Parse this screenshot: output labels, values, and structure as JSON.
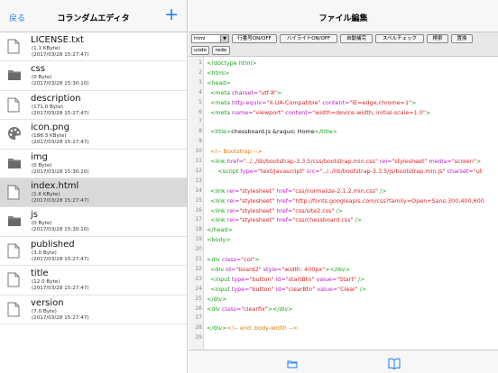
{
  "left": {
    "back_label": "戻る",
    "title": "コランダムエディタ",
    "add_label": "+"
  },
  "files": [
    {
      "name": "LICENSE.txt",
      "size": "(1.1 KByte)",
      "date": "(2017/03/28 15:27:47)",
      "icon": "document-icon",
      "selected": false
    },
    {
      "name": "css",
      "size": "(0 Byte)",
      "date": "(2017/03/28 15:30:10)",
      "icon": "folder-icon",
      "selected": false
    },
    {
      "name": "description",
      "size": "(171.0 Byte)",
      "date": "(2017/03/28 15:27:47)",
      "icon": "document-icon",
      "selected": false
    },
    {
      "name": "icon.png",
      "size": "(186.3 KByte)",
      "date": "(2017/03/28 15:27:47)",
      "icon": "palette-icon",
      "selected": false
    },
    {
      "name": "img",
      "size": "(0 Byte)",
      "date": "(2017/03/28 15:30:10)",
      "icon": "folder-icon",
      "selected": false
    },
    {
      "name": "index.html",
      "size": "(1.6 KByte)",
      "date": "(2017/03/28 15:27:47)",
      "icon": "document-icon",
      "selected": true
    },
    {
      "name": "js",
      "size": "(0 Byte)",
      "date": "(2017/03/28 15:30:10)",
      "icon": "folder-icon",
      "selected": false
    },
    {
      "name": "published",
      "size": "(3.0 Byte)",
      "date": "(2017/03/28 15:27:47)",
      "icon": "document-icon",
      "selected": false
    },
    {
      "name": "title",
      "size": "(12.0 Byte)",
      "date": "(2017/03/28 15:27:47)",
      "icon": "document-icon",
      "selected": false
    },
    {
      "name": "version",
      "size": "(7.0 Byte)",
      "date": "(2017/03/28 15:27:47)",
      "icon": "document-icon",
      "selected": false
    }
  ],
  "right": {
    "title": "ファイル編集"
  },
  "toolbar": {
    "mode_value": "html",
    "mode_arrow": "▼",
    "line_numbers": "行番号ON/OFF",
    "highlight": "ハイライトON/OFF",
    "autocomplete": "自動補完",
    "spellcheck": "スペルチェック",
    "search": "検索",
    "replace": "置換",
    "undo": "undo",
    "redo": "redo"
  },
  "code_lines": [
    {
      "n": "1",
      "parts": [
        {
          "c": "tag",
          "t": "<!doctype html>"
        }
      ]
    },
    {
      "n": "2",
      "parts": [
        {
          "c": "tag",
          "t": "<html>"
        }
      ]
    },
    {
      "n": "3",
      "parts": [
        {
          "c": "tag",
          "t": "<head>"
        }
      ]
    },
    {
      "n": "4",
      "parts": [
        {
          "c": "tag",
          "t": "  <meta "
        },
        {
          "c": "attr",
          "t": "charset="
        },
        {
          "c": "val",
          "t": "\"utf-8\""
        },
        {
          "c": "tag",
          "t": ">"
        }
      ]
    },
    {
      "n": "5",
      "parts": [
        {
          "c": "tag",
          "t": "  <meta "
        },
        {
          "c": "attr",
          "t": "http-equiv="
        },
        {
          "c": "val",
          "t": "\"X-UA-Compatible\""
        },
        {
          "c": "attr",
          "t": " content="
        },
        {
          "c": "val",
          "t": "\"IE=edge,chrome=1\""
        },
        {
          "c": "tag",
          "t": ">"
        }
      ]
    },
    {
      "n": "6",
      "parts": [
        {
          "c": "tag",
          "t": "  <meta "
        },
        {
          "c": "attr",
          "t": "name="
        },
        {
          "c": "val",
          "t": "\"viewport\""
        },
        {
          "c": "attr",
          "t": " content="
        },
        {
          "c": "val",
          "t": "\"width=device-width, initial-scale=1.0\""
        },
        {
          "c": "tag",
          "t": ">"
        }
      ]
    },
    {
      "n": "7",
      "parts": []
    },
    {
      "n": "8",
      "parts": [
        {
          "c": "tag",
          "t": "  <title>"
        },
        {
          "c": "txt",
          "t": "chessboard.js &raquo; Home"
        },
        {
          "c": "tag",
          "t": "</title>"
        }
      ]
    },
    {
      "n": "9",
      "parts": []
    },
    {
      "n": "10",
      "parts": [
        {
          "c": "cmt",
          "t": "  <!-- Bootstrap -->"
        }
      ]
    },
    {
      "n": "11",
      "parts": [
        {
          "c": "tag",
          "t": "  <link "
        },
        {
          "c": "attr",
          "t": "href="
        },
        {
          "c": "val",
          "t": "\"../../lib/bootstrap-3.3.5/css/bootstrap.min.css\""
        },
        {
          "c": "attr",
          "t": " rel="
        },
        {
          "c": "val",
          "t": "\"stylesheet\""
        },
        {
          "c": "attr",
          "t": " media="
        },
        {
          "c": "val",
          "t": "\"screen\""
        },
        {
          "c": "tag",
          "t": ">"
        }
      ]
    },
    {
      "n": "12",
      "parts": [
        {
          "c": "tag",
          "t": "      <script "
        },
        {
          "c": "attr",
          "t": "type="
        },
        {
          "c": "val",
          "t": "\"text/javascript\""
        },
        {
          "c": "attr",
          "t": " src="
        },
        {
          "c": "val",
          "t": "\"../../lib/bootstrap-3.3.5/js/bootstrap.min.js\""
        },
        {
          "c": "attr",
          "t": " charset="
        },
        {
          "c": "val",
          "t": "\"ut"
        }
      ]
    },
    {
      "n": "13",
      "parts": []
    },
    {
      "n": "14",
      "parts": [
        {
          "c": "tag",
          "t": "  <link "
        },
        {
          "c": "attr",
          "t": "rel="
        },
        {
          "c": "val",
          "t": "\"stylesheet\""
        },
        {
          "c": "attr",
          "t": " href="
        },
        {
          "c": "val",
          "t": "\"css/normalize-2.1.2.min.css\""
        },
        {
          "c": "tag",
          "t": " />"
        }
      ]
    },
    {
      "n": "15",
      "parts": [
        {
          "c": "tag",
          "t": "  <link "
        },
        {
          "c": "attr",
          "t": "rel="
        },
        {
          "c": "val",
          "t": "\"stylesheet\""
        },
        {
          "c": "attr",
          "t": " href="
        },
        {
          "c": "val",
          "t": "\"http://fonts.googleapis.com/css?family=Open+Sans:300,400,600"
        }
      ]
    },
    {
      "n": "16",
      "parts": [
        {
          "c": "tag",
          "t": "  <link "
        },
        {
          "c": "attr",
          "t": "rel="
        },
        {
          "c": "val",
          "t": "\"stylesheet\""
        },
        {
          "c": "attr",
          "t": " href="
        },
        {
          "c": "val",
          "t": "\"css/site2.css\""
        },
        {
          "c": "tag",
          "t": " />"
        }
      ]
    },
    {
      "n": "17",
      "parts": [
        {
          "c": "tag",
          "t": "  <link "
        },
        {
          "c": "attr",
          "t": "rel="
        },
        {
          "c": "val",
          "t": "\"stylesheet\""
        },
        {
          "c": "attr",
          "t": " href="
        },
        {
          "c": "val",
          "t": "\"css/chessboard.css\""
        },
        {
          "c": "tag",
          "t": " />"
        }
      ]
    },
    {
      "n": "18",
      "parts": [
        {
          "c": "tag",
          "t": "</head>"
        }
      ]
    },
    {
      "n": "19",
      "parts": [
        {
          "c": "tag",
          "t": "<body>"
        }
      ]
    },
    {
      "n": "20",
      "parts": []
    },
    {
      "n": "21",
      "parts": [
        {
          "c": "tag",
          "t": "<div "
        },
        {
          "c": "attr",
          "t": "class="
        },
        {
          "c": "val",
          "t": "\"col\""
        },
        {
          "c": "tag",
          "t": ">"
        }
      ]
    },
    {
      "n": "22",
      "parts": [
        {
          "c": "tag",
          "t": "  <div "
        },
        {
          "c": "attr",
          "t": "id="
        },
        {
          "c": "val",
          "t": "\"board2\""
        },
        {
          "c": "attr",
          "t": " style="
        },
        {
          "c": "val",
          "t": "\"width: 400px\""
        },
        {
          "c": "tag",
          "t": "></div>"
        }
      ]
    },
    {
      "n": "23",
      "parts": [
        {
          "c": "tag",
          "t": "  <input "
        },
        {
          "c": "attr",
          "t": "type="
        },
        {
          "c": "val",
          "t": "\"button\""
        },
        {
          "c": "attr",
          "t": " id="
        },
        {
          "c": "val",
          "t": "\"startBtn\""
        },
        {
          "c": "attr",
          "t": " value="
        },
        {
          "c": "val",
          "t": "\"Start\""
        },
        {
          "c": "tag",
          "t": " />"
        }
      ]
    },
    {
      "n": "24",
      "parts": [
        {
          "c": "tag",
          "t": "  <input "
        },
        {
          "c": "attr",
          "t": "type="
        },
        {
          "c": "val",
          "t": "\"button\""
        },
        {
          "c": "attr",
          "t": " id="
        },
        {
          "c": "val",
          "t": "\"clearBtn\""
        },
        {
          "c": "attr",
          "t": " value="
        },
        {
          "c": "val",
          "t": "\"Clear\""
        },
        {
          "c": "tag",
          "t": " />"
        }
      ]
    },
    {
      "n": "25",
      "parts": [
        {
          "c": "tag",
          "t": "</div>"
        }
      ]
    },
    {
      "n": "26",
      "parts": [
        {
          "c": "tag",
          "t": "<div "
        },
        {
          "c": "attr",
          "t": "class="
        },
        {
          "c": "val",
          "t": "\"clearfix\""
        },
        {
          "c": "tag",
          "t": "></div>"
        }
      ]
    },
    {
      "n": "27",
      "parts": []
    },
    {
      "n": "28",
      "parts": [
        {
          "c": "tag",
          "t": "</div>"
        },
        {
          "c": "cmt",
          "t": "<!-- end .body-width -->"
        }
      ]
    },
    {
      "n": "29",
      "parts": []
    }
  ],
  "bottom": {
    "left_icon": "folder-icon",
    "right_icon": "book-icon"
  },
  "colors": {
    "accent": "#1a7cf5",
    "tag": "#16a516",
    "attr": "#b81ec8",
    "value": "#dd2222",
    "comment": "#e47a00"
  }
}
